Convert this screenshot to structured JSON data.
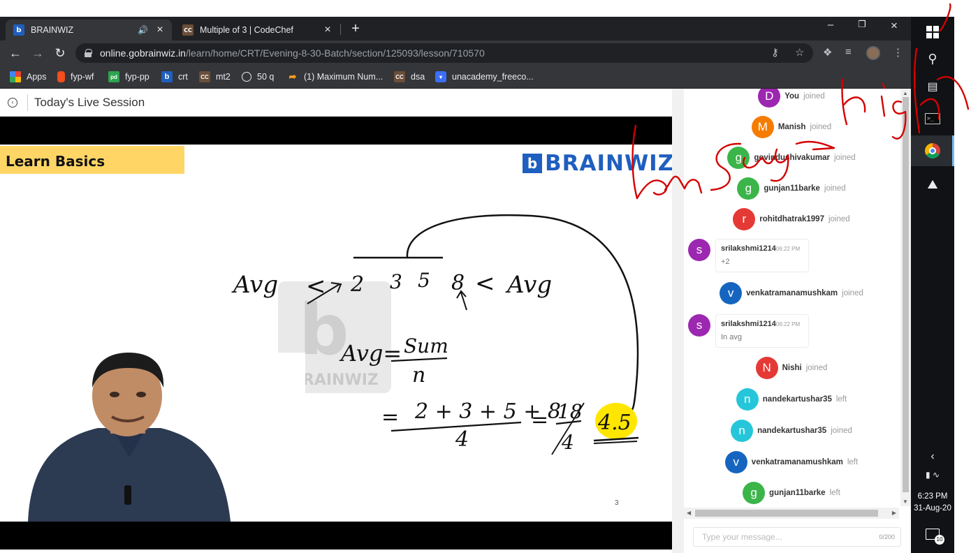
{
  "browser": {
    "tabs": [
      {
        "title": "BRAINWIZ",
        "favicon": "brainwiz-favicon",
        "audio_icon": "speaker-icon",
        "active": true
      },
      {
        "title": "Multiple of 3 | CodeChef",
        "favicon": "codechef-favicon",
        "active": false
      }
    ],
    "url": {
      "host": "online.gobrainwiz.in",
      "path": "/learn/home/CRT/Evening-8-30-Batch/section/125093/lesson/710570"
    },
    "bookmarks": [
      {
        "label": "Apps",
        "icon": "apps-grid-icon",
        "color": "#ea4335"
      },
      {
        "label": "fyp-wf",
        "icon": "figma-icon",
        "color": "#f24e1e"
      },
      {
        "label": "fyp-pp",
        "icon": "pd-icon",
        "color": "#2da44e"
      },
      {
        "label": "crt",
        "icon": "brainwiz-favicon",
        "color": "#1f5fbf"
      },
      {
        "label": "mt2",
        "icon": "codechef-favicon",
        "color": "#6b4f3a"
      },
      {
        "label": "50 q",
        "icon": "globe-icon",
        "color": "#9aa0a6"
      },
      {
        "label": "(1) Maximum Num...",
        "icon": "leetcode-icon",
        "color": "#f89f1b"
      },
      {
        "label": "dsa",
        "icon": "codechef-favicon",
        "color": "#6b4f3a"
      },
      {
        "label": "unacademy_freeco...",
        "icon": "unacademy-icon",
        "color": "#3b6ff5"
      }
    ]
  },
  "page": {
    "title": "Today's Live Session"
  },
  "slide": {
    "banner": "Learn Basics",
    "logo_letter": "b",
    "logo_text": "BRAINWIZ",
    "watermark_text": "BRAINWIZ",
    "page_number": "3",
    "handwriting": {
      "avg_left": "Avg",
      "lt_left": "<",
      "numbers": [
        "2",
        "3",
        "5",
        "8"
      ],
      "lt_right": "<",
      "avg_right": "Avg",
      "formula_lhs": "Avg=",
      "formula_num": "Sum",
      "formula_den": "n",
      "eq1": "=",
      "calc_num": "2 + 3 + 5 + 8",
      "calc_den": "4",
      "eq2": "=",
      "frac_num": "18",
      "frac_den": "4",
      "result": "4.5"
    }
  },
  "chat": {
    "events": [
      {
        "type": "join",
        "initial": "D",
        "name": "You",
        "status": "joined",
        "color": "#9c27b0"
      },
      {
        "type": "join",
        "initial": "M",
        "name": "Manish",
        "status": "joined",
        "color": "#f57c00"
      },
      {
        "type": "join",
        "initial": "g",
        "name": "govindushivakumar",
        "status": "joined",
        "color": "#3bb54a"
      },
      {
        "type": "join",
        "initial": "g",
        "name": "gunjan11barke",
        "status": "joined",
        "color": "#3bb54a"
      },
      {
        "type": "join",
        "initial": "r",
        "name": "rohitdhatrak1997",
        "status": "joined",
        "color": "#e53935"
      },
      {
        "type": "msg",
        "initial": "s",
        "name": "srilakshmi1214",
        "time": "06:22 PM",
        "text": "+2",
        "color": "#9c27b0"
      },
      {
        "type": "join",
        "initial": "v",
        "name": "venkatramanamushkam",
        "status": "joined",
        "color": "#1565c0"
      },
      {
        "type": "msg",
        "initial": "s",
        "name": "srilakshmi1214",
        "time": "06:22 PM",
        "text": "In avg",
        "color": "#9c27b0"
      },
      {
        "type": "join",
        "initial": "N",
        "name": "Nishi",
        "status": "joined",
        "color": "#e53935"
      },
      {
        "type": "join",
        "initial": "n",
        "name": "nandekartushar35",
        "status": "left",
        "color": "#26c6da"
      },
      {
        "type": "join",
        "initial": "n",
        "name": "nandekartushar35",
        "status": "joined",
        "color": "#26c6da"
      },
      {
        "type": "join",
        "initial": "v",
        "name": "venkatramanamushkam",
        "status": "left",
        "color": "#1565c0"
      },
      {
        "type": "join",
        "initial": "g",
        "name": "gunjan11barke",
        "status": "left",
        "color": "#3bb54a"
      }
    ],
    "input_placeholder": "Type your message...",
    "char_count": "0/200"
  },
  "taskbar": {
    "icons": [
      "windows-start-icon",
      "search-icon",
      "task-view-icon",
      "terminal-icon",
      "chrome-icon",
      "photos-icon"
    ],
    "time": "6:23 PM",
    "date": "31-Aug-20",
    "notifications": "10"
  },
  "annotation": {
    "color": "#d40000",
    "words": [
      "lower",
      "Range",
      "higher"
    ]
  }
}
